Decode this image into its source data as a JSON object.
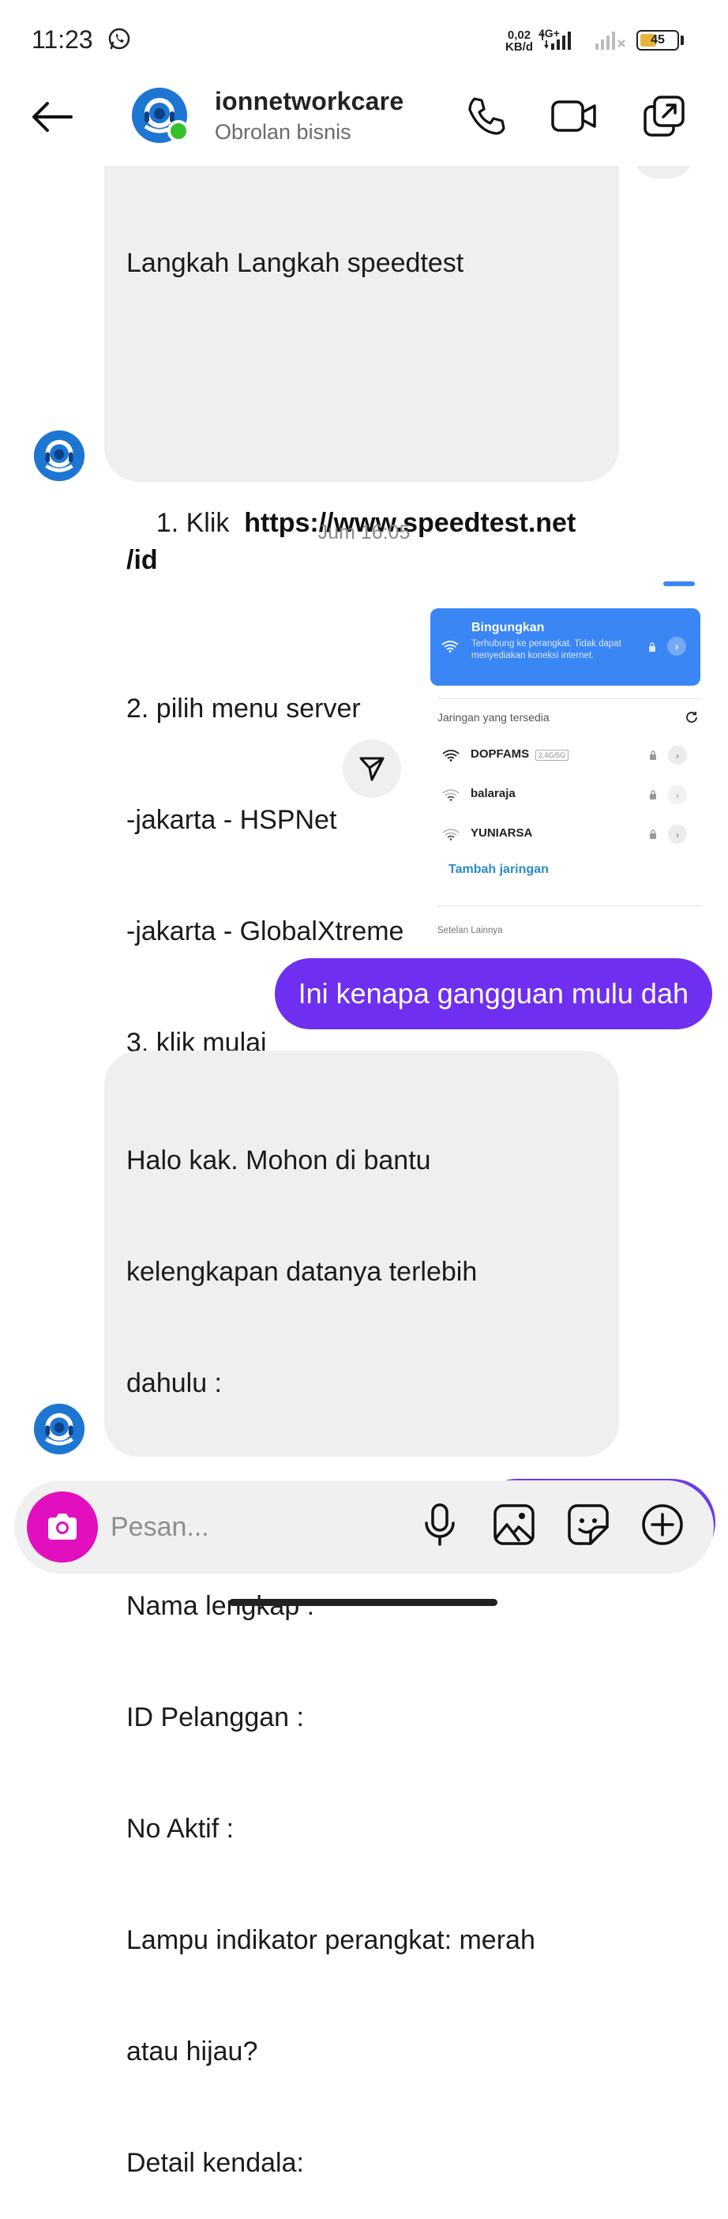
{
  "status_bar": {
    "time": "11:23",
    "net_speed_value": "0,02",
    "net_speed_unit": "KB/d",
    "network_type": "4G+",
    "battery": "45"
  },
  "header": {
    "name": "ionnetworkcare",
    "subtitle": "Obrolan bisnis"
  },
  "messages": {
    "speedtest": {
      "title": "Langkah Langkah speedtest",
      "step1_prefix": "1. Klik  ",
      "step1_link": "https://www.speedtest.net /id",
      "lines": [
        "2. pilih menu server",
        "-jakarta - HSPNet",
        "-jakarta - GlobalXtreme",
        "3. klik mulai"
      ]
    },
    "timestamp": "Jum 16:05",
    "outgoing_text": "Ini kenapa gangguan mulu dah",
    "form_request": {
      "lines": [
        "Halo kak. Mohon di bantu",
        "kelengkapan datanya terlebih",
        "dahulu :",
        "",
        "Nama lengkap :",
        "ID Pelanggan :",
        "No Aktif :",
        "Lampu indikator perangkat: merah",
        "atau hijau?",
        "Detail kendala:"
      ]
    }
  },
  "shared_screenshot": {
    "connected_title": "Bingungkan",
    "connected_desc": "Terhubung ke perangkat. Tidak dapat menyediakan koneksi internet.",
    "section_title": "Jaringan yang tersedia",
    "networks": [
      {
        "name": "DOPFAMS",
        "badge": "2.4G/5G"
      },
      {
        "name": "balaraja",
        "badge": ""
      },
      {
        "name": "YUNIARSA",
        "badge": ""
      }
    ],
    "add_network": "Tambah jaringan",
    "more_settings": "Setelan Lainnya"
  },
  "composer": {
    "placeholder": "Pesan..."
  },
  "colors": {
    "outgoing_bubble": "#6e2ff0",
    "incoming_bubble": "#efefef",
    "camera_button": "#e10fbe",
    "online": "#36c02b",
    "wifi_card": "#3a86f4"
  },
  "icons": [
    "whatsapp-icon",
    "back-arrow-icon",
    "phone-icon",
    "video-camera-icon",
    "switch-window-icon",
    "send-icon",
    "camera-icon",
    "microphone-icon",
    "image-icon",
    "sticker-icon",
    "plus-circle-icon"
  ]
}
